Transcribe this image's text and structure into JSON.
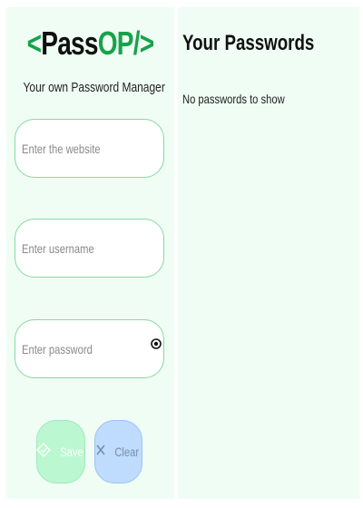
{
  "logo": {
    "open": "<",
    "left_word": "Pass",
    "right_word": "OP",
    "close": "/>"
  },
  "tagline": "Your own Password Manager",
  "form": {
    "website_placeholder": "Enter the website",
    "username_placeholder": "Enter username",
    "password_placeholder": "Enter password",
    "save_label": "Save",
    "clear_label": "Clear"
  },
  "passwords": {
    "title": "Your Passwords",
    "empty_text": "No passwords to show"
  },
  "icons": {
    "eye": "eye-icon",
    "save": "add-lock-icon",
    "clear": "x-icon"
  },
  "colors": {
    "brand_green": "#16a34a",
    "panel_bg": "#f0fdf4",
    "input_border": "#86d9a0",
    "save_bg": "#bbf7d0",
    "clear_bg": "#bfdbfe"
  }
}
